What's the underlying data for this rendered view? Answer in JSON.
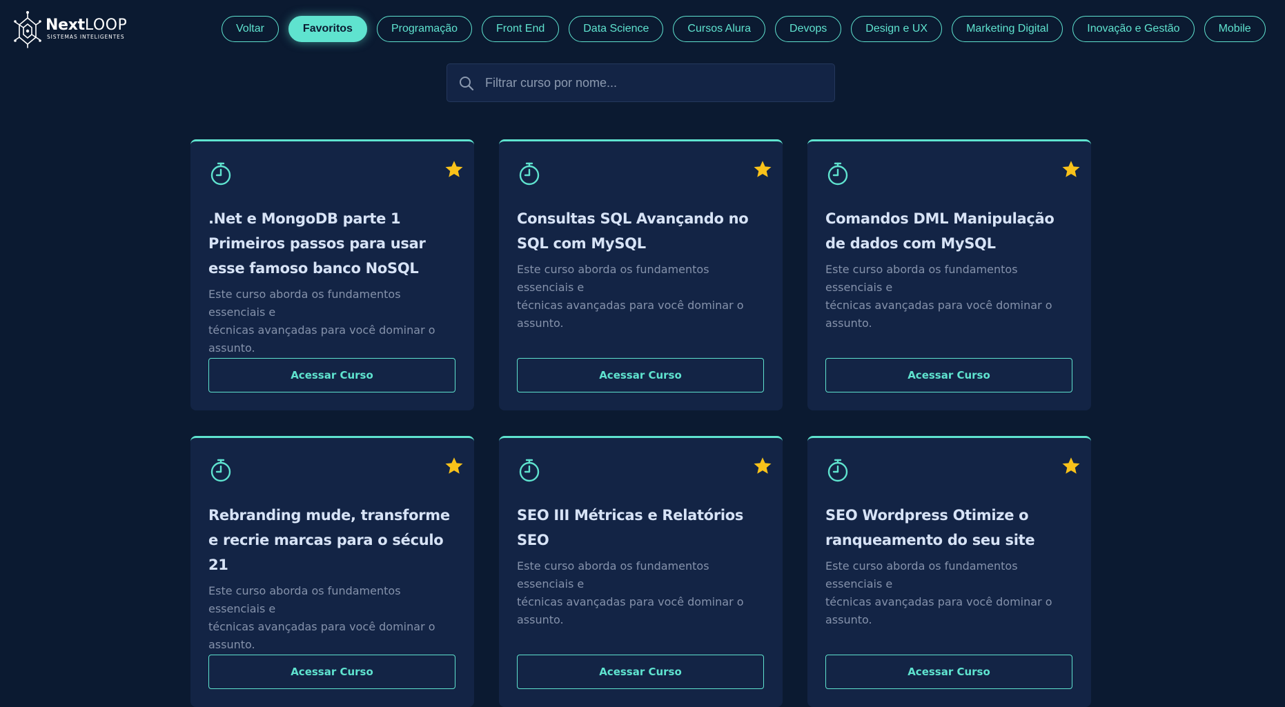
{
  "logo": {
    "brand_bold": "Next",
    "brand_light": "LOOP",
    "tagline": "SISTEMAS INTELIGENTES"
  },
  "nav": [
    {
      "label": "Voltar",
      "active": false
    },
    {
      "label": "Favoritos",
      "active": true
    },
    {
      "label": "Programação",
      "active": false
    },
    {
      "label": "Front End",
      "active": false
    },
    {
      "label": "Data Science",
      "active": false
    },
    {
      "label": "Cursos Alura",
      "active": false
    },
    {
      "label": "Devops",
      "active": false
    },
    {
      "label": "Design e UX",
      "active": false
    },
    {
      "label": "Marketing Digital",
      "active": false
    },
    {
      "label": "Inovação e Gestão",
      "active": false
    },
    {
      "label": "Mobile",
      "active": false
    }
  ],
  "search": {
    "placeholder": "Filtrar curso por nome..."
  },
  "colors": {
    "accent": "#5fe3cf",
    "star": "#f9c21a",
    "background": "#0b1a31",
    "card": "#132445"
  },
  "cards": [
    {
      "title_lines": [
        ".Net e MongoDB parte 1",
        "Primeiros passos para usar",
        "esse famoso banco NoSQL"
      ],
      "description_lines": [
        "Este curso aborda os fundamentos essenciais e",
        "técnicas avançadas para você dominar o",
        "assunto."
      ],
      "button": "Acessar Curso",
      "favorite": true
    },
    {
      "title_lines": [
        "Consultas SQL Avançando no",
        "SQL com MySQL"
      ],
      "description_lines": [
        "Este curso aborda os fundamentos essenciais e",
        "técnicas avançadas para você dominar o",
        "assunto."
      ],
      "button": "Acessar Curso",
      "favorite": true
    },
    {
      "title_lines": [
        "Comandos DML Manipulação",
        "de dados com MySQL"
      ],
      "description_lines": [
        "Este curso aborda os fundamentos essenciais e",
        "técnicas avançadas para você dominar o",
        "assunto."
      ],
      "button": "Acessar Curso",
      "favorite": true
    },
    {
      "title_lines": [
        "Rebranding mude, transforme",
        "e recrie marcas para o século",
        "21"
      ],
      "description_lines": [
        "Este curso aborda os fundamentos essenciais e",
        "técnicas avançadas para você dominar o",
        "assunto."
      ],
      "button": "Acessar Curso",
      "favorite": true
    },
    {
      "title_lines": [
        "SEO III Métricas e Relatórios",
        "SEO"
      ],
      "description_lines": [
        "Este curso aborda os fundamentos essenciais e",
        "técnicas avançadas para você dominar o",
        "assunto."
      ],
      "button": "Acessar Curso",
      "favorite": true
    },
    {
      "title_lines": [
        "SEO Wordpress Otimize o",
        "ranqueamento do seu site"
      ],
      "description_lines": [
        "Este curso aborda os fundamentos essenciais e",
        "técnicas avançadas para você dominar o",
        "assunto."
      ],
      "button": "Acessar Curso",
      "favorite": true
    }
  ]
}
